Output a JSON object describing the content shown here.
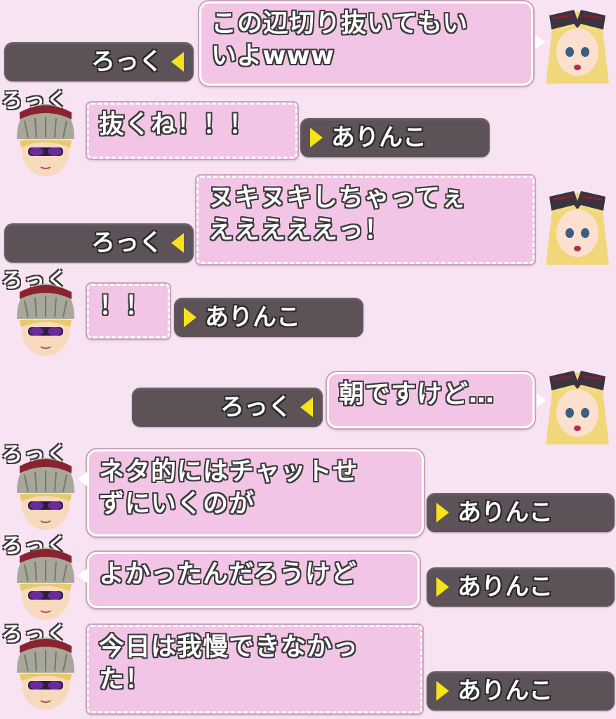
{
  "colors": {
    "background": "#f7e3f2",
    "bubble": "#f2c4e6",
    "nameplate": "#5c5258",
    "arrow": "#f6e419"
  },
  "messages": [
    {
      "side": "right",
      "speaker": "ろっく",
      "avatar": "blonde-girl-bow-avatar",
      "text": "この辺切り抜いてもい\nいよwww"
    },
    {
      "side": "left",
      "speaker": "ありんこ",
      "avatar": "knit-cap-sunglasses-avatar",
      "tag": "ろっく",
      "text": "抜くね！！！"
    },
    {
      "side": "right",
      "speaker": "ろっく",
      "avatar": "blonde-girl-bow-avatar",
      "text": "ヌキヌキしちゃってぇ\nえええええっ！"
    },
    {
      "side": "left",
      "speaker": "ありんこ",
      "avatar": "knit-cap-sunglasses-avatar",
      "tag": "ろっく",
      "text": "！！"
    },
    {
      "side": "right",
      "speaker": "ろっく",
      "avatar": "blonde-girl-bow-avatar",
      "text": "朝ですけど…"
    },
    {
      "side": "left",
      "speaker": "ありんこ",
      "avatar": "knit-cap-sunglasses-avatar",
      "tag": "ろっく",
      "text": "ネタ的にはチャットせ\nずにいくのが"
    },
    {
      "side": "left",
      "speaker": "ありんこ",
      "avatar": "knit-cap-sunglasses-avatar",
      "tag": "ろっく",
      "text": "よかったんだろうけど"
    },
    {
      "side": "left",
      "speaker": "ありんこ",
      "avatar": "knit-cap-sunglasses-avatar",
      "tag": "ろっく",
      "text": "今日は我慢できなかっ\nた！"
    }
  ]
}
